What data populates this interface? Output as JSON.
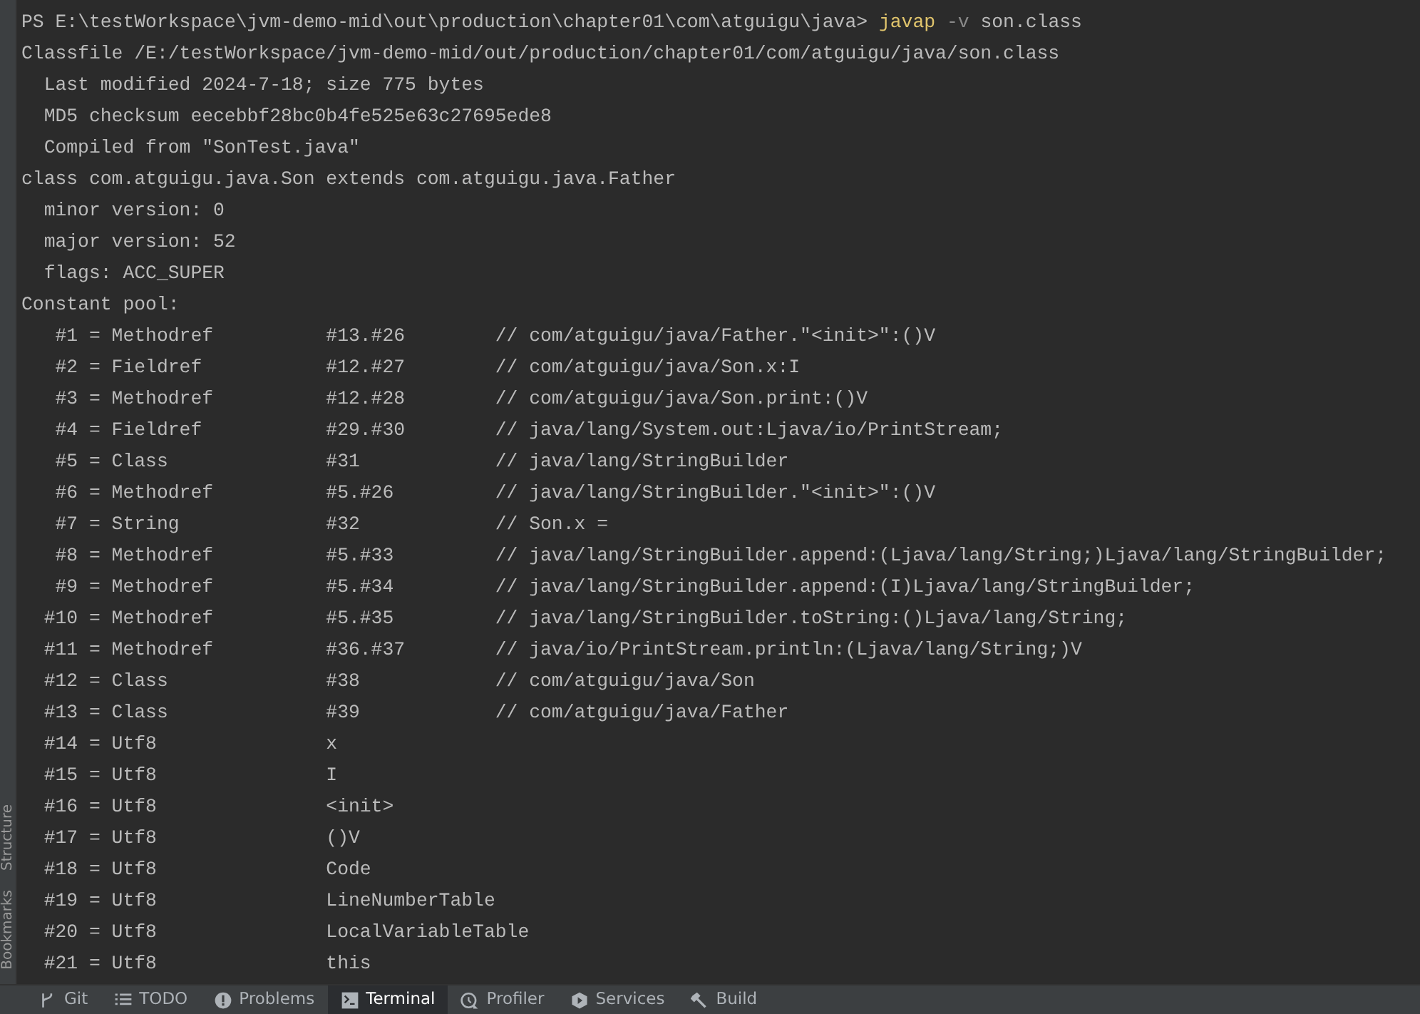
{
  "side_panel": {
    "labels": [
      "Structure",
      "Bookmarks"
    ]
  },
  "terminal": {
    "prompt": "PS E:\\testWorkspace\\jvm-demo-mid\\out\\production\\chapter01\\com\\atguigu\\java>",
    "command": "javap",
    "flag": "-v",
    "argument": "son.class",
    "header_lines": [
      {
        "indented": false,
        "text": "Classfile /E:/testWorkspace/jvm-demo-mid/out/production/chapter01/com/atguigu/java/son.class"
      },
      {
        "indented": true,
        "text": "Last modified 2024-7-18; size 775 bytes"
      },
      {
        "indented": true,
        "text": "MD5 checksum eecebbf28bc0b4fe525e63c27695ede8"
      },
      {
        "indented": true,
        "text": "Compiled from \"SonTest.java\""
      },
      {
        "indented": false,
        "text": "class com.atguigu.java.Son extends com.atguigu.java.Father"
      },
      {
        "indented": true,
        "text": "minor version: 0"
      },
      {
        "indented": true,
        "text": "major version: 52"
      },
      {
        "indented": true,
        "text": "flags: ACC_SUPER"
      },
      {
        "indented": false,
        "text": "Constant pool:"
      }
    ],
    "constant_pool": [
      {
        "index": "#1",
        "type": "= Methodref",
        "ref": "#13.#26",
        "comment": "// com/atguigu/java/Father.\"<init>\":()V"
      },
      {
        "index": "#2",
        "type": "= Fieldref",
        "ref": "#12.#27",
        "comment": "// com/atguigu/java/Son.x:I"
      },
      {
        "index": "#3",
        "type": "= Methodref",
        "ref": "#12.#28",
        "comment": "// com/atguigu/java/Son.print:()V"
      },
      {
        "index": "#4",
        "type": "= Fieldref",
        "ref": "#29.#30",
        "comment": "// java/lang/System.out:Ljava/io/PrintStream;"
      },
      {
        "index": "#5",
        "type": "= Class",
        "ref": "#31",
        "comment": "// java/lang/StringBuilder"
      },
      {
        "index": "#6",
        "type": "= Methodref",
        "ref": "#5.#26",
        "comment": "// java/lang/StringBuilder.\"<init>\":()V"
      },
      {
        "index": "#7",
        "type": "= String",
        "ref": "#32",
        "comment": "// Son.x ="
      },
      {
        "index": "#8",
        "type": "= Methodref",
        "ref": "#5.#33",
        "comment": "// java/lang/StringBuilder.append:(Ljava/lang/String;)Ljava/lang/StringBuilder;"
      },
      {
        "index": "#9",
        "type": "= Methodref",
        "ref": "#5.#34",
        "comment": "// java/lang/StringBuilder.append:(I)Ljava/lang/StringBuilder;"
      },
      {
        "index": "#10",
        "type": "= Methodref",
        "ref": "#5.#35",
        "comment": "// java/lang/StringBuilder.toString:()Ljava/lang/String;"
      },
      {
        "index": "#11",
        "type": "= Methodref",
        "ref": "#36.#37",
        "comment": "// java/io/PrintStream.println:(Ljava/lang/String;)V"
      },
      {
        "index": "#12",
        "type": "= Class",
        "ref": "#38",
        "comment": "// com/atguigu/java/Son"
      },
      {
        "index": "#13",
        "type": "= Class",
        "ref": "#39",
        "comment": "// com/atguigu/java/Father"
      },
      {
        "index": "#14",
        "type": "= Utf8",
        "ref": "x"
      },
      {
        "index": "#15",
        "type": "= Utf8",
        "ref": "I"
      },
      {
        "index": "#16",
        "type": "= Utf8",
        "ref": "<init>"
      },
      {
        "index": "#17",
        "type": "= Utf8",
        "ref": "()V"
      },
      {
        "index": "#18",
        "type": "= Utf8",
        "ref": "Code"
      },
      {
        "index": "#19",
        "type": "= Utf8",
        "ref": "LineNumberTable"
      },
      {
        "index": "#20",
        "type": "= Utf8",
        "ref": "LocalVariableTable"
      },
      {
        "index": "#21",
        "type": "= Utf8",
        "ref": "this"
      }
    ]
  },
  "tool_tabs": [
    {
      "label": "Git",
      "selected": false
    },
    {
      "label": "TODO",
      "selected": false
    },
    {
      "label": "Problems",
      "selected": false
    },
    {
      "label": "Terminal",
      "selected": true
    },
    {
      "label": "Profiler",
      "selected": false
    },
    {
      "label": "Services",
      "selected": false
    },
    {
      "label": "Build",
      "selected": false
    }
  ]
}
